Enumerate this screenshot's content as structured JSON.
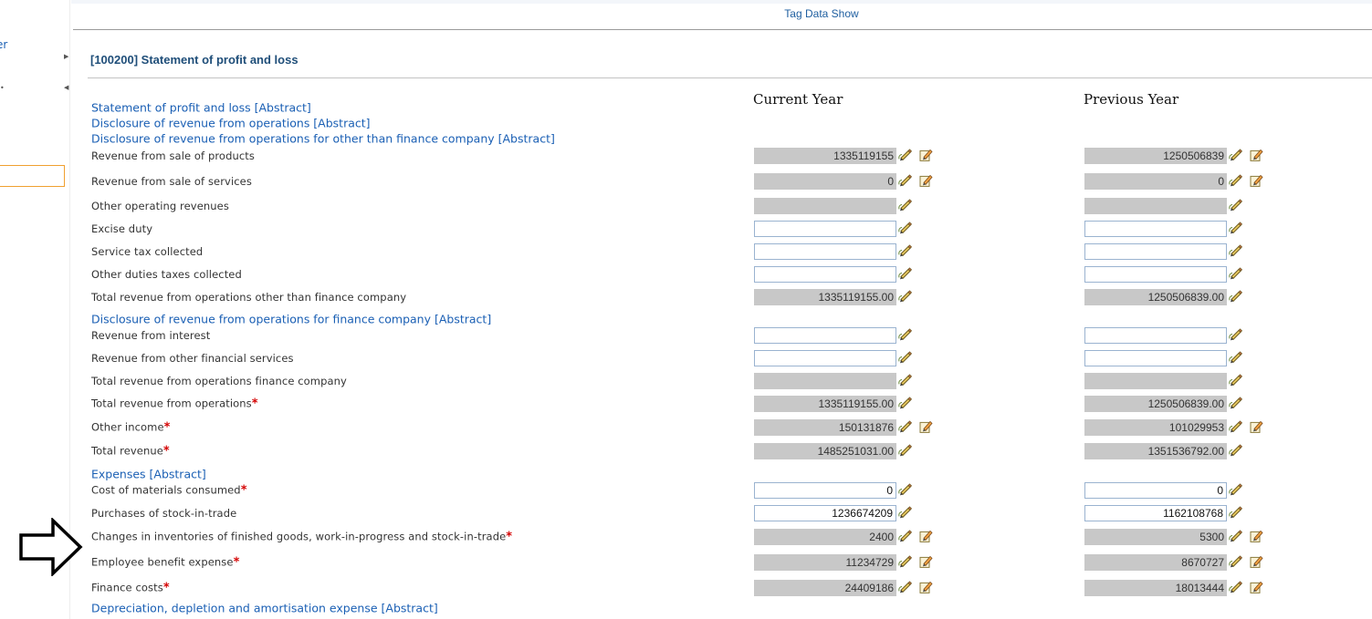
{
  "sidebar": {
    "partial_text": "er"
  },
  "header": {
    "title": "Tag Data Show"
  },
  "section": {
    "title": "[100200] Statement of profit and loss"
  },
  "columns": {
    "current": "Current Year",
    "previous": "Previous Year"
  },
  "rows": [
    {
      "type": "abstract",
      "label": "Statement of profit and loss [Abstract]"
    },
    {
      "type": "abstract",
      "label": "Disclosure of revenue from operations [Abstract]"
    },
    {
      "type": "abstract",
      "label": "Disclosure of revenue from operations for other than finance company [Abstract]"
    },
    {
      "type": "item",
      "label": "Revenue from sale of products",
      "required": false,
      "current": "1335119155",
      "previous": "1250506839",
      "editable": false,
      "detail": true
    },
    {
      "type": "item",
      "label": "Revenue from sale of services",
      "required": false,
      "current": "0",
      "previous": "0",
      "editable": false,
      "detail": true
    },
    {
      "type": "item",
      "label": "Other operating revenues",
      "required": false,
      "current": "",
      "previous": "",
      "editable": false,
      "detail": false
    },
    {
      "type": "item",
      "label": "Excise duty",
      "required": false,
      "current": "",
      "previous": "",
      "editable": true,
      "detail": false
    },
    {
      "type": "item",
      "label": "Service tax collected",
      "required": false,
      "current": "",
      "previous": "",
      "editable": true,
      "detail": false
    },
    {
      "type": "item",
      "label": "Other duties taxes collected",
      "required": false,
      "current": "",
      "previous": "",
      "editable": true,
      "detail": false
    },
    {
      "type": "item",
      "label": "Total revenue from operations other than finance company",
      "required": false,
      "current": "1335119155.00",
      "previous": "1250506839.00",
      "editable": false,
      "detail": false
    },
    {
      "type": "abstract",
      "label": "Disclosure of revenue from operations for finance company [Abstract]"
    },
    {
      "type": "item",
      "label": "Revenue from interest",
      "required": false,
      "current": "",
      "previous": "",
      "editable": true,
      "detail": false
    },
    {
      "type": "item",
      "label": "Revenue from other financial services",
      "required": false,
      "current": "",
      "previous": "",
      "editable": true,
      "detail": false
    },
    {
      "type": "item",
      "label": "Total revenue from operations finance company",
      "required": false,
      "current": "",
      "previous": "",
      "editable": false,
      "detail": false
    },
    {
      "type": "item",
      "label": "Total revenue from operations",
      "required": true,
      "current": "1335119155.00",
      "previous": "1250506839.00",
      "editable": false,
      "detail": false
    },
    {
      "type": "item",
      "label": "Other income",
      "required": true,
      "current": "150131876",
      "previous": "101029953",
      "editable": false,
      "detail": true
    },
    {
      "type": "item",
      "label": "Total revenue",
      "required": true,
      "current": "1485251031.00",
      "previous": "1351536792.00",
      "editable": false,
      "detail": false
    },
    {
      "type": "abstract",
      "label": "Expenses [Abstract]"
    },
    {
      "type": "item",
      "label": "Cost of materials consumed",
      "required": true,
      "current": "0",
      "previous": "0",
      "editable": true,
      "detail": false
    },
    {
      "type": "item",
      "label": "Purchases of stock-in-trade",
      "required": false,
      "current": "1236674209",
      "previous": "1162108768",
      "editable": true,
      "detail": false
    },
    {
      "type": "item",
      "label": "Changes in inventories of finished goods, work-in-progress and stock-in-trade",
      "required": true,
      "current": "2400",
      "previous": "5300",
      "editable": false,
      "detail": true
    },
    {
      "type": "item",
      "label": "Employee benefit expense",
      "required": true,
      "current": "11234729",
      "previous": "8670727",
      "editable": false,
      "detail": true
    },
    {
      "type": "item",
      "label": "Finance costs",
      "required": true,
      "current": "24409186",
      "previous": "18013444",
      "editable": false,
      "detail": true
    },
    {
      "type": "abstract",
      "label": "Depreciation, depletion and amortisation expense [Abstract]"
    }
  ],
  "required_marker": "*",
  "colors": {
    "link": "#1a5fb4",
    "readonly_field": "#c8c8c8",
    "required": "#d40000",
    "title": "#1f4e79"
  }
}
